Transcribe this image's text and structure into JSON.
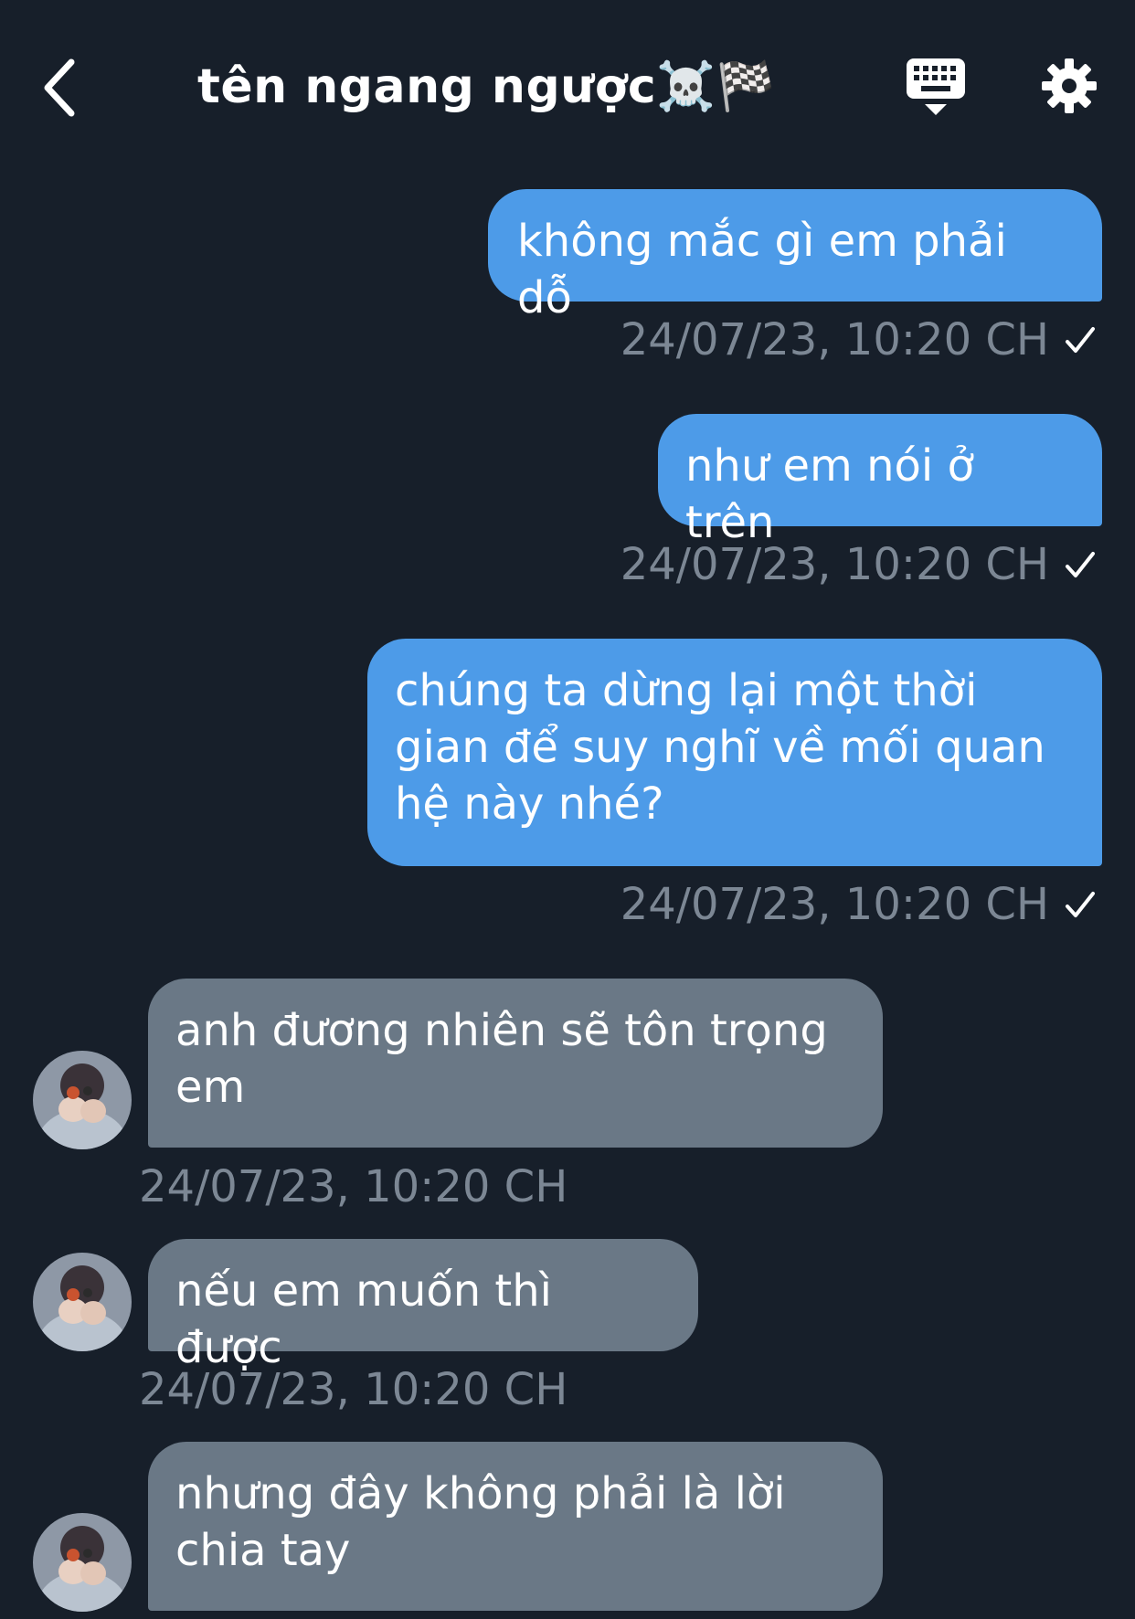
{
  "header": {
    "title": "tên ngang ngược☠️🏁",
    "back_icon": "chevron-left-icon",
    "keyboard_icon": "keyboard-dismiss-icon",
    "settings_icon": "gear-icon"
  },
  "colors": {
    "background": "#171f2a",
    "outgoing_bubble": "#4d9be8",
    "incoming_bubble": "#6a7886",
    "timestamp": "#7c8794"
  },
  "messages": [
    {
      "direction": "out",
      "text": "không mắc gì em phải dỗ",
      "time": "24/07/23, 10:20 CH",
      "read": true
    },
    {
      "direction": "out",
      "text": "như em nói ở trên",
      "time": "24/07/23, 10:20 CH",
      "read": true
    },
    {
      "direction": "out",
      "text": "chúng ta dừng lại một thời gian để suy nghĩ về mối quan hệ này nhé?",
      "time": "24/07/23, 10:20 CH",
      "read": true
    },
    {
      "direction": "in",
      "text": "anh đương nhiên sẽ tôn trọng em",
      "time": "24/07/23, 10:20 CH"
    },
    {
      "direction": "in",
      "text": "nếu em muốn thì được",
      "time": "24/07/23, 10:20 CH"
    },
    {
      "direction": "in",
      "text": "nhưng đây không phải là lời chia tay",
      "time": ""
    }
  ]
}
